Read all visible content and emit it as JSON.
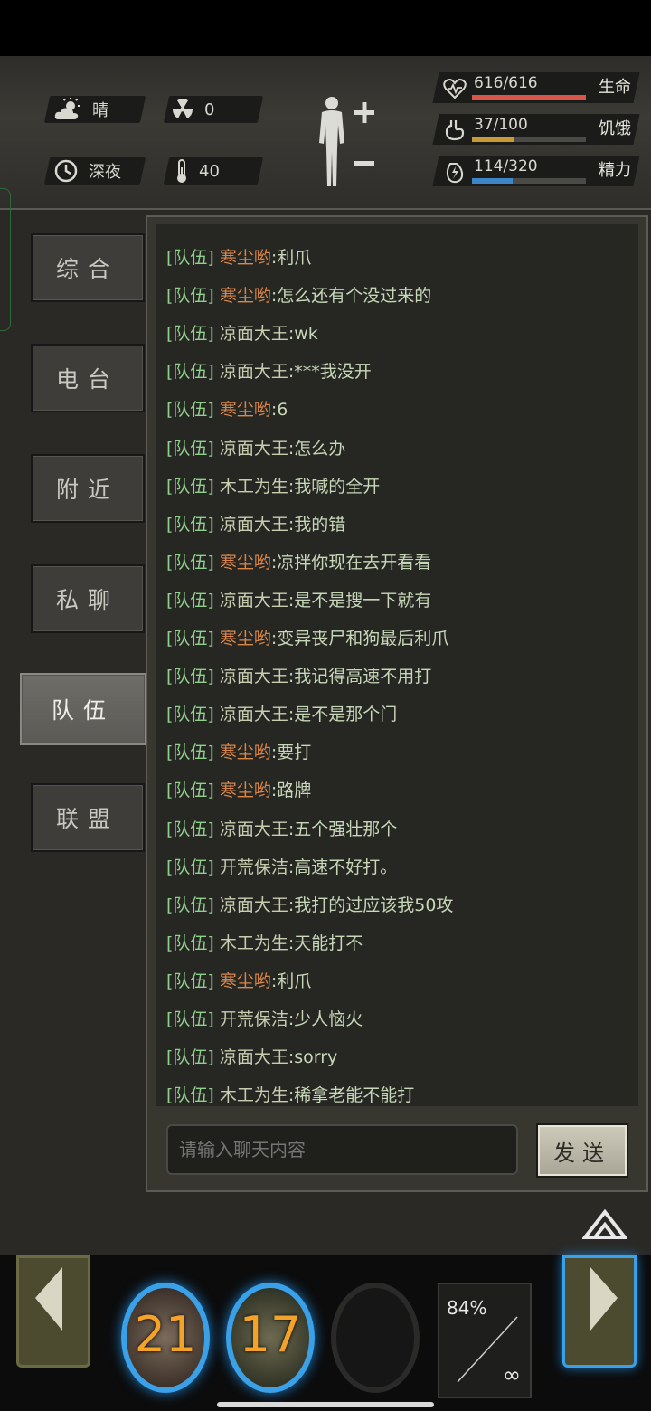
{
  "status": {
    "weather": "晴",
    "radiation": "0",
    "time_of_day": "深夜",
    "temperature": "40"
  },
  "stats": {
    "health": {
      "value": "616/616",
      "label": "生命",
      "fraction": 1.0,
      "color": "#d9554a"
    },
    "hunger": {
      "value": "37/100",
      "label": "饥饿",
      "fraction": 0.37,
      "color": "#c99a3a"
    },
    "energy": {
      "value": "114/320",
      "label": "精力",
      "fraction": 0.356,
      "color": "#3c86c8"
    }
  },
  "tabs": [
    {
      "label": "综合"
    },
    {
      "label": "电台"
    },
    {
      "label": "附近"
    },
    {
      "label": "私聊"
    },
    {
      "label": "队伍",
      "active": true
    },
    {
      "label": "联盟"
    }
  ],
  "chat": {
    "messages": [
      {
        "channel": "[队伍]",
        "name": "寒尘哟",
        "me": true,
        "text": ":利爪"
      },
      {
        "channel": "[队伍]",
        "name": "寒尘哟",
        "me": true,
        "text": ":怎么还有个没过来的"
      },
      {
        "channel": "[队伍]",
        "name": "凉面大王",
        "me": false,
        "text": ":wk"
      },
      {
        "channel": "[队伍]",
        "name": "凉面大王",
        "me": false,
        "text": ":***我没开"
      },
      {
        "channel": "[队伍]",
        "name": "寒尘哟",
        "me": true,
        "text": ":6"
      },
      {
        "channel": "[队伍]",
        "name": "凉面大王",
        "me": false,
        "text": ":怎么办"
      },
      {
        "channel": "[队伍]",
        "name": "木工为生",
        "me": false,
        "text": ":我喊的全开"
      },
      {
        "channel": "[队伍]",
        "name": "凉面大王",
        "me": false,
        "text": ":我的错"
      },
      {
        "channel": "[队伍]",
        "name": "寒尘哟",
        "me": true,
        "text": ":凉拌你现在去开看看"
      },
      {
        "channel": "[队伍]",
        "name": "凉面大王",
        "me": false,
        "text": ":是不是搜一下就有"
      },
      {
        "channel": "[队伍]",
        "name": "寒尘哟",
        "me": true,
        "text": ":变异丧尸和狗最后利爪"
      },
      {
        "channel": "[队伍]",
        "name": "凉面大王",
        "me": false,
        "text": ":我记得高速不用打"
      },
      {
        "channel": "[队伍]",
        "name": "凉面大王",
        "me": false,
        "text": ":是不是那个门"
      },
      {
        "channel": "[队伍]",
        "name": "寒尘哟",
        "me": true,
        "text": ":要打"
      },
      {
        "channel": "[队伍]",
        "name": "寒尘哟",
        "me": true,
        "text": ":路牌"
      },
      {
        "channel": "[队伍]",
        "name": "凉面大王",
        "me": false,
        "text": ":五个强壮那个"
      },
      {
        "channel": "[队伍]",
        "name": "开荒保洁",
        "me": false,
        "text": ":高速不好打。"
      },
      {
        "channel": "[队伍]",
        "name": "凉面大王",
        "me": false,
        "text": ":我打的过应该我50攻"
      },
      {
        "channel": "[队伍]",
        "name": "木工为生",
        "me": false,
        "text": ":天能打不"
      },
      {
        "channel": "[队伍]",
        "name": "寒尘哟",
        "me": true,
        "text": ":利爪"
      },
      {
        "channel": "[队伍]",
        "name": "开荒保洁",
        "me": false,
        "text": ":少人恼火"
      },
      {
        "channel": "[队伍]",
        "name": "凉面大王",
        "me": false,
        "text": ":sorry"
      },
      {
        "channel": "[队伍]",
        "name": "木工为生",
        "me": false,
        "text": ":稀拿老能不能打"
      }
    ],
    "input_placeholder": "请输入聊天内容",
    "send_label": "发送"
  },
  "hotbar": {
    "skill_1": "21",
    "skill_2": "17",
    "weapon_durability": "84%",
    "weapon_ammo": "∞"
  }
}
